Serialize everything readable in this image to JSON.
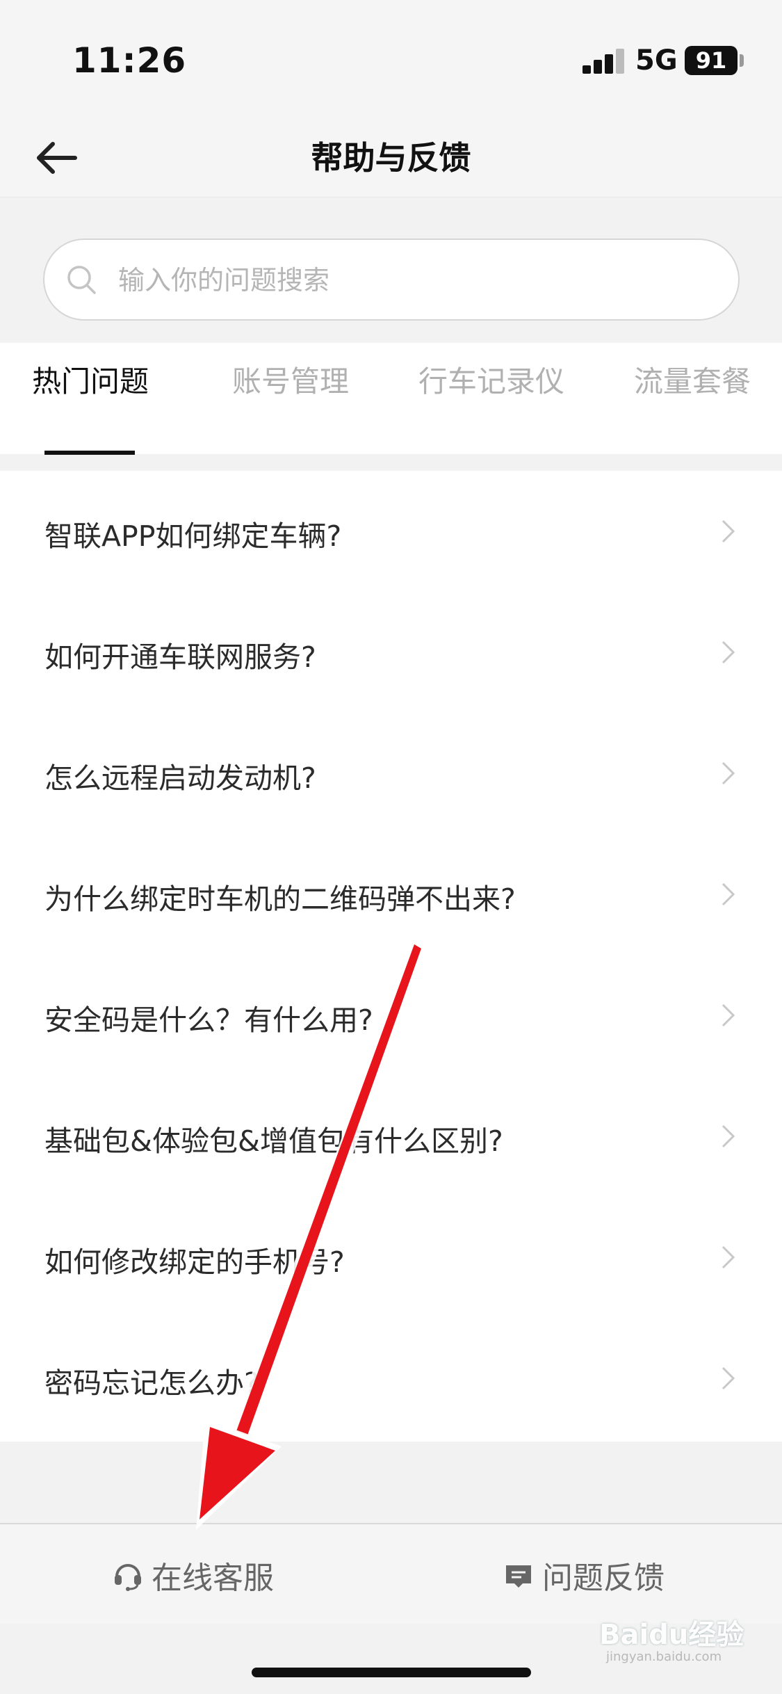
{
  "status_bar": {
    "time": "11:26",
    "network": "5G",
    "battery": "91"
  },
  "nav": {
    "title": "帮助与反馈",
    "back_icon": "back-arrow-icon"
  },
  "search": {
    "placeholder": "输入你的问题搜索",
    "value": ""
  },
  "tabs": [
    {
      "label": "热门问题",
      "active": true
    },
    {
      "label": "账号管理",
      "active": false
    },
    {
      "label": "行车记录仪",
      "active": false
    },
    {
      "label": "流量套餐",
      "active": false
    }
  ],
  "faq": [
    "智联APP如何绑定车辆?",
    "如何开通车联网服务?",
    "怎么远程启动发动机?",
    "为什么绑定时车机的二维码弹不出来?",
    "安全码是什么？有什么用?",
    "基础包&体验包&增值包有什么区别?",
    "如何修改绑定的手机号?",
    "密码忘记怎么办?"
  ],
  "bottom_bar": {
    "left_label": "在线客服",
    "left_icon": "headset-icon",
    "right_label": "问题反馈",
    "right_icon": "feedback-icon"
  },
  "watermark": {
    "text": "Baidu经验",
    "sub": "jingyan.baidu.com"
  },
  "colors": {
    "annotation_arrow": "#e8141c",
    "tab_active": "#111111",
    "tab_inactive": "#b0b0b0"
  }
}
